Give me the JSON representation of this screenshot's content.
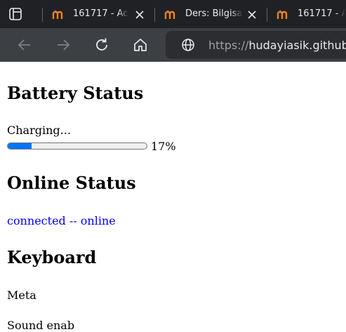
{
  "browser": {
    "tabs": [
      {
        "title": "161717 - Ac",
        "active": false
      },
      {
        "title": "Ders: Bilgisa",
        "active": false
      },
      {
        "title": "161717 - A",
        "active": false
      }
    ],
    "url_prefix": "https://",
    "url_host": "hudayiasik.github."
  },
  "battery": {
    "heading": "Battery Status",
    "state": "Charging...",
    "level_percent": 17,
    "level_label": "17%"
  },
  "online": {
    "heading": "Online Status",
    "status": "connected -- online",
    "color": "#0000ee"
  },
  "keyboard": {
    "heading": "Keyboard",
    "key": "Meta",
    "next_line": "Sound enab"
  },
  "colors": {
    "chrome_tabbar": "#202124",
    "chrome_toolbar": "#3c4045",
    "progress_fill": "#0075ff"
  }
}
